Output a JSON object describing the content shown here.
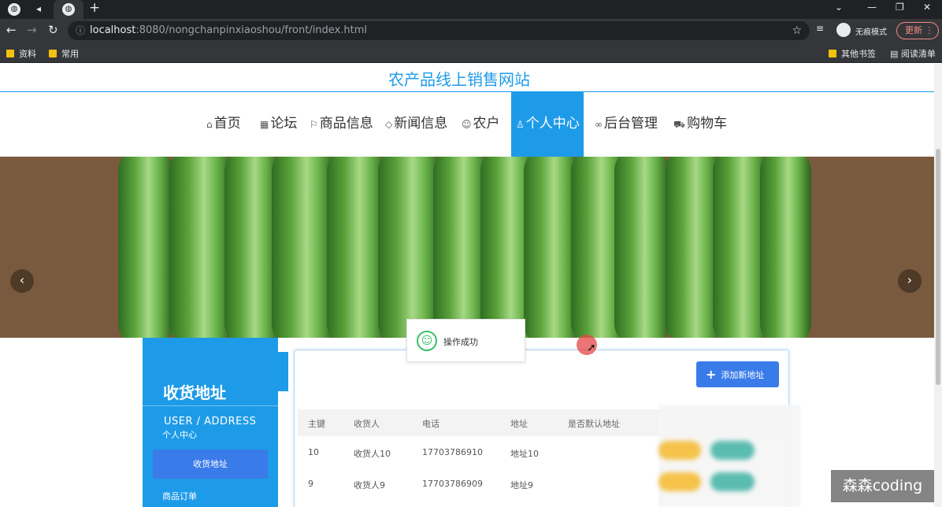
{
  "browser": {
    "url_host": "localhost",
    "url_path": ":8080/nongchanpinxiaoshou/front/index.html",
    "incognito_label": "无痕模式",
    "update_label": "更新",
    "bookmarks": [
      "资料",
      "常用"
    ],
    "bookmarks_right": [
      "其他书签",
      "阅读清单"
    ]
  },
  "site": {
    "title": "农产品线上销售网站",
    "nav": [
      {
        "icon": "home-icon",
        "label": "首页"
      },
      {
        "icon": "forum-icon",
        "label": "论坛"
      },
      {
        "icon": "flag-icon",
        "label": "商品信息"
      },
      {
        "icon": "tag-icon",
        "label": "新闻信息"
      },
      {
        "icon": "farmer-icon",
        "label": "农户"
      },
      {
        "icon": "user-icon",
        "label": "个人中心",
        "active": true
      },
      {
        "icon": "link-icon",
        "label": "后台管理"
      },
      {
        "icon": "cart-icon",
        "label": "购物车"
      }
    ]
  },
  "sidebar": {
    "title": "收货地址",
    "subtitle_en": "USER / ADDRESS",
    "subtitle_cn": "个人中心",
    "active_item": "收货地址",
    "next_item": "商品订单"
  },
  "main": {
    "add_button": "添加新地址",
    "columns": [
      "主键",
      "收货人",
      "电话",
      "地址",
      "是否默认地址"
    ],
    "rows": [
      {
        "id": "10",
        "name": "收货人10",
        "phone": "17703786910",
        "address": "地址10"
      },
      {
        "id": "9",
        "name": "收货人9",
        "phone": "17703786909",
        "address": "地址9"
      }
    ]
  },
  "toast": {
    "message": "操作成功"
  },
  "watermark": "森森coding",
  "colors": {
    "accent": "#1e9be8",
    "button": "#3a7bea",
    "success": "#3cbf6a"
  }
}
